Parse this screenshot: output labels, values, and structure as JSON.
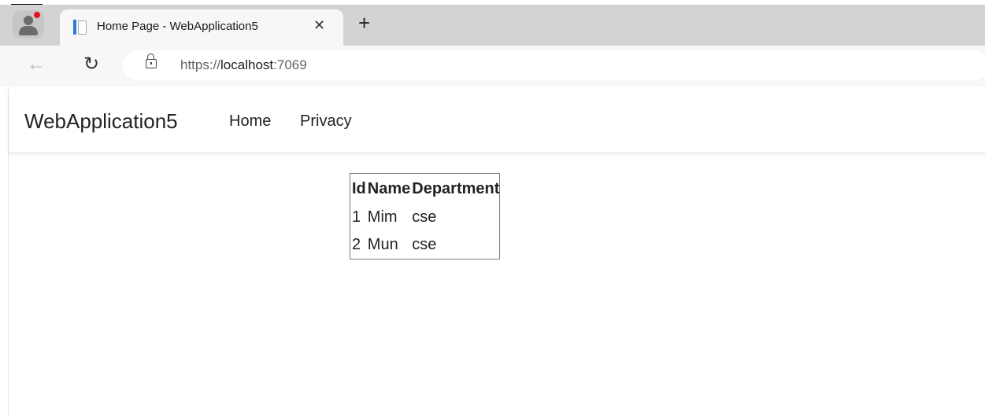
{
  "browser": {
    "tab": {
      "title": "Home Page - WebApplication5",
      "close_glyph": "✕",
      "favicon": "page-icon"
    },
    "new_tab_glyph": "+",
    "back_glyph": "←",
    "reload_glyph": "↻",
    "address": {
      "scheme": "https://",
      "host": "localhost",
      "port": ":7069"
    },
    "colors": {
      "tabbar": "#d3d3d3",
      "toolbar": "#f7f7f7",
      "profile_badge": "#e81123",
      "favicon_accent": "#2f7bd6"
    }
  },
  "navbar": {
    "brand": "WebApplication5",
    "links": [
      "Home",
      "Privacy"
    ]
  },
  "table": {
    "headers": [
      "Id",
      "Name",
      "Department"
    ],
    "rows": [
      [
        "1",
        "Mim",
        "cse"
      ],
      [
        "2",
        "Mun",
        "cse"
      ]
    ]
  }
}
